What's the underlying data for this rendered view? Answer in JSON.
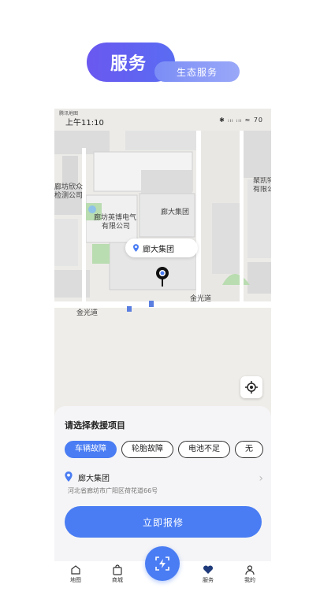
{
  "header": {
    "title": "服务",
    "subtitle": "生态服务"
  },
  "status_bar": {
    "map_tag": "腾讯地图",
    "time": "上午11:10",
    "right_icons": "✱ ᵢₗₗ ᵢₗₗ ≈ 70"
  },
  "map": {
    "labels": [
      "廊坊英博电气",
      "有限公司",
      "廊大集团",
      "廊坊欣众",
      "检测公司",
      "聚凯特",
      "金光道",
      "金光道",
      "有限公"
    ],
    "callout": "廊大集团"
  },
  "panel": {
    "title": "请选择救援项目",
    "chips": [
      {
        "label": "车辆故障",
        "active": true
      },
      {
        "label": "轮胎故障",
        "active": false
      },
      {
        "label": "电池不足",
        "active": false
      },
      {
        "label": "无",
        "active": false
      }
    ],
    "address_name": "廊大集团",
    "address_detail": "河北省廊坊市广阳区荷花道66号",
    "repair_button": "立即报修"
  },
  "tabs": [
    {
      "label": "地图",
      "icon": "home-icon"
    },
    {
      "label": "商城",
      "icon": "shopping-bag-icon"
    },
    {
      "label": "服务",
      "icon": "heart-service-icon",
      "active": true
    },
    {
      "label": "我的",
      "icon": "user-icon"
    }
  ],
  "colors": {
    "accent": "#4a7df3",
    "badge": "#6a58f0"
  }
}
